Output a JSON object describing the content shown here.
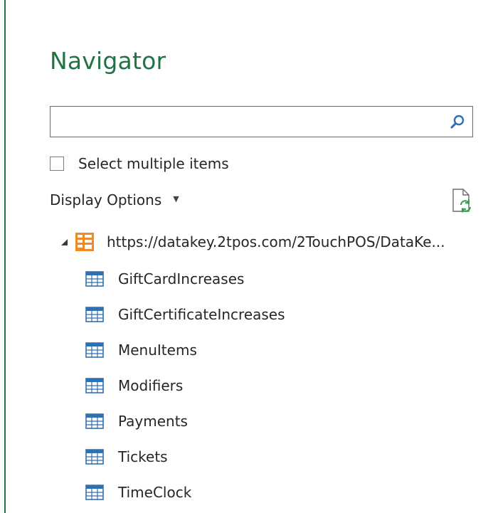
{
  "title": "Navigator",
  "search": {
    "value": "",
    "placeholder": ""
  },
  "select_multiple": {
    "label": "Select multiple items",
    "checked": false
  },
  "display_options": {
    "label": "Display Options",
    "caret_icon": "caret-down-icon"
  },
  "refresh": {
    "icon": "refresh-document-icon"
  },
  "tree": {
    "root": {
      "label": "https://datakey.2tpos.com/2TouchPOS/DataKe...",
      "icon": "data-feed-icon",
      "expanded": true
    },
    "items": [
      {
        "label": "GiftCardIncreases",
        "icon": "table-icon"
      },
      {
        "label": "GiftCertificateIncreases",
        "icon": "table-icon"
      },
      {
        "label": "MenuItems",
        "icon": "table-icon"
      },
      {
        "label": "Modifiers",
        "icon": "table-icon"
      },
      {
        "label": "Payments",
        "icon": "table-icon"
      },
      {
        "label": "Tickets",
        "icon": "table-icon"
      },
      {
        "label": "TimeClock",
        "icon": "table-icon"
      }
    ]
  },
  "colors": {
    "accent": "#217346",
    "text": "#262626",
    "orange": "#F08A24",
    "table_blue": "#2F6FB3"
  }
}
